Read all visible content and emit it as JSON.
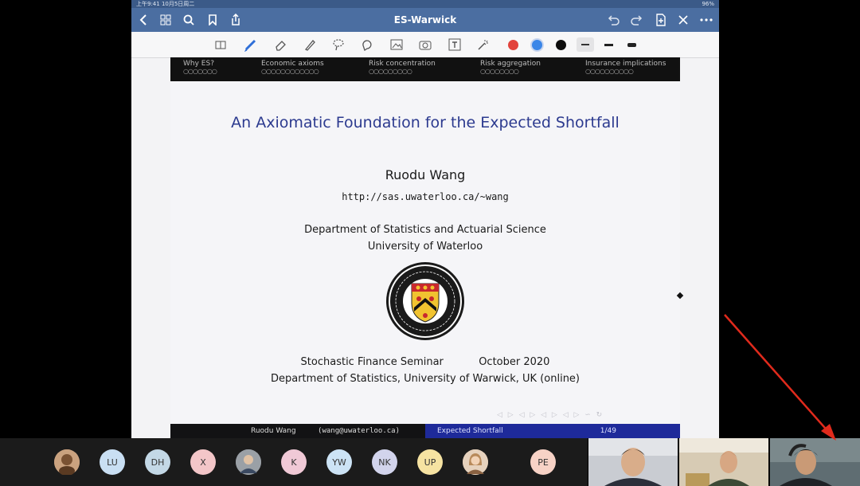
{
  "status_bar": {
    "time_date": "上午9:41 10月5日周二",
    "battery": "96%"
  },
  "app": {
    "document_title": "ES-Warwick"
  },
  "toolbar": {
    "colors": {
      "red": "#e2433c",
      "blue": "#3a86e8",
      "black": "#0d0d0d"
    }
  },
  "slide": {
    "nav_sections": [
      "Why ES?",
      "Economic axioms",
      "Risk concentration",
      "Risk aggregation",
      "Insurance implications"
    ],
    "title": "An Axiomatic Foundation for the Expected Shortfall",
    "author": "Ruodu Wang",
    "url": "http://sas.uwaterloo.ca/~wang",
    "department": "Department of Statistics and Actuarial Science",
    "university": "University of Waterloo",
    "seminar": "Stochastic Finance Seminar",
    "date": "October 2020",
    "event": "Department of Statistics, University of Warwick, UK (online)",
    "footer_author": "Ruodu Wang",
    "footer_email": "(wang@uwaterloo.ca)",
    "footer_title": "Expected Shortfall",
    "footer_page": "1/49"
  },
  "participants": [
    {
      "initials": "",
      "color": "#c49a7a",
      "name": ""
    },
    {
      "initials": "LU",
      "color": "#c9dff3",
      "name": ""
    },
    {
      "initials": "DH",
      "color": "#c3d8e6",
      "name": ""
    },
    {
      "initials": "X",
      "color": "#f3c6c8",
      "name": ""
    },
    {
      "initials": "",
      "color": "#8a8f96",
      "name": ""
    },
    {
      "initials": "K",
      "color": "#f0c9d6",
      "name": ""
    },
    {
      "initials": "YW",
      "color": "#cce3f5",
      "name": ""
    },
    {
      "initials": "NK",
      "color": "#d2d4ec",
      "name": ""
    },
    {
      "initials": "UP",
      "color": "#f6e3a2",
      "name": ""
    },
    {
      "initials": "",
      "color": "#d9b99b",
      "name": ""
    },
    {
      "initials": "PE",
      "color": "#f7d2c6",
      "name": ""
    }
  ]
}
